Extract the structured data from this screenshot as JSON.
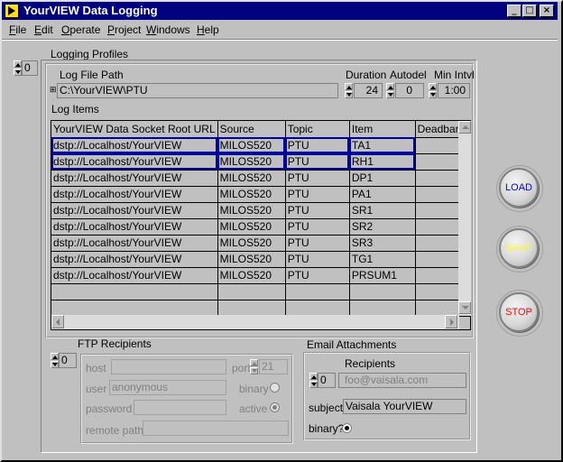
{
  "window": {
    "title": "YourVIEW Data Logging",
    "minimize": "_",
    "maximize": "□",
    "close": "×"
  },
  "menu": [
    {
      "label": "File",
      "accel": "F",
      "rest": "ile"
    },
    {
      "label": "Edit",
      "accel": "E",
      "rest": "dit"
    },
    {
      "label": "Operate",
      "accel": "O",
      "rest": "perate"
    },
    {
      "label": "Project",
      "accel": "P",
      "rest": "roject"
    },
    {
      "label": "Windows",
      "accel": "W",
      "rest": "indows"
    },
    {
      "label": "Help",
      "accel": "H",
      "rest": "elp"
    }
  ],
  "profiles": {
    "label": "Logging Profiles",
    "index": "0",
    "log_file_path_label": "Log File Path",
    "log_file_path_value": "C:\\YourVIEW\\PTU",
    "duration_label": "Duration",
    "duration_value": "24",
    "autodel_label": "Autodel",
    "autodel_value": "0",
    "min_intvl_label": "Min Intvl",
    "min_intvl_value": "1:00"
  },
  "log_items": {
    "label": "Log Items",
    "columns": [
      "YourVIEW Data Socket Root URL",
      "Source",
      "Topic",
      "Item",
      "Deadband"
    ],
    "rows": [
      [
        "dstp://Localhost/YourVIEW",
        "MILOS520",
        "PTU",
        "TA1",
        ""
      ],
      [
        "dstp://Localhost/YourVIEW",
        "MILOS520",
        "PTU",
        "RH1",
        ""
      ],
      [
        "dstp://Localhost/YourVIEW",
        "MILOS520",
        "PTU",
        "DP1",
        ""
      ],
      [
        "dstp://Localhost/YourVIEW",
        "MILOS520",
        "PTU",
        "PA1",
        ""
      ],
      [
        "dstp://Localhost/YourVIEW",
        "MILOS520",
        "PTU",
        "SR1",
        ""
      ],
      [
        "dstp://Localhost/YourVIEW",
        "MILOS520",
        "PTU",
        "SR2",
        ""
      ],
      [
        "dstp://Localhost/YourVIEW",
        "MILOS520",
        "PTU",
        "SR3",
        ""
      ],
      [
        "dstp://Localhost/YourVIEW",
        "MILOS520",
        "PTU",
        "TG1",
        ""
      ],
      [
        "dstp://Localhost/YourVIEW",
        "MILOS520",
        "PTU",
        "PRSUM1",
        ""
      ],
      [
        "",
        "",
        "",
        "",
        ""
      ],
      [
        "",
        "",
        "",
        "",
        ""
      ]
    ]
  },
  "buttons": {
    "load": "LOAD",
    "save": "SAVE",
    "stop": "STOP",
    "load_color": "#0000ff",
    "save_color": "#ffff00",
    "stop_color": "#ff0000"
  },
  "ftp": {
    "label": "FTP Recipients",
    "index": "0",
    "host_label": "host",
    "host_value": "",
    "port_label": "port",
    "port_value": "21",
    "user_label": "user",
    "user_value": "anonymous",
    "password_label": "password",
    "password_value": "",
    "binary_label": "binary",
    "active_label": "active",
    "remote_path_label": "remote path",
    "remote_path_value": ""
  },
  "email": {
    "label": "Email Attachments",
    "recipients_label": "Recipients",
    "index": "0",
    "recipient_value": "foo@vaisala.com",
    "subject_label": "subject",
    "subject_value": "Vaisala YourVIEW",
    "binary_label": "binary?"
  },
  "outer_index": "0"
}
